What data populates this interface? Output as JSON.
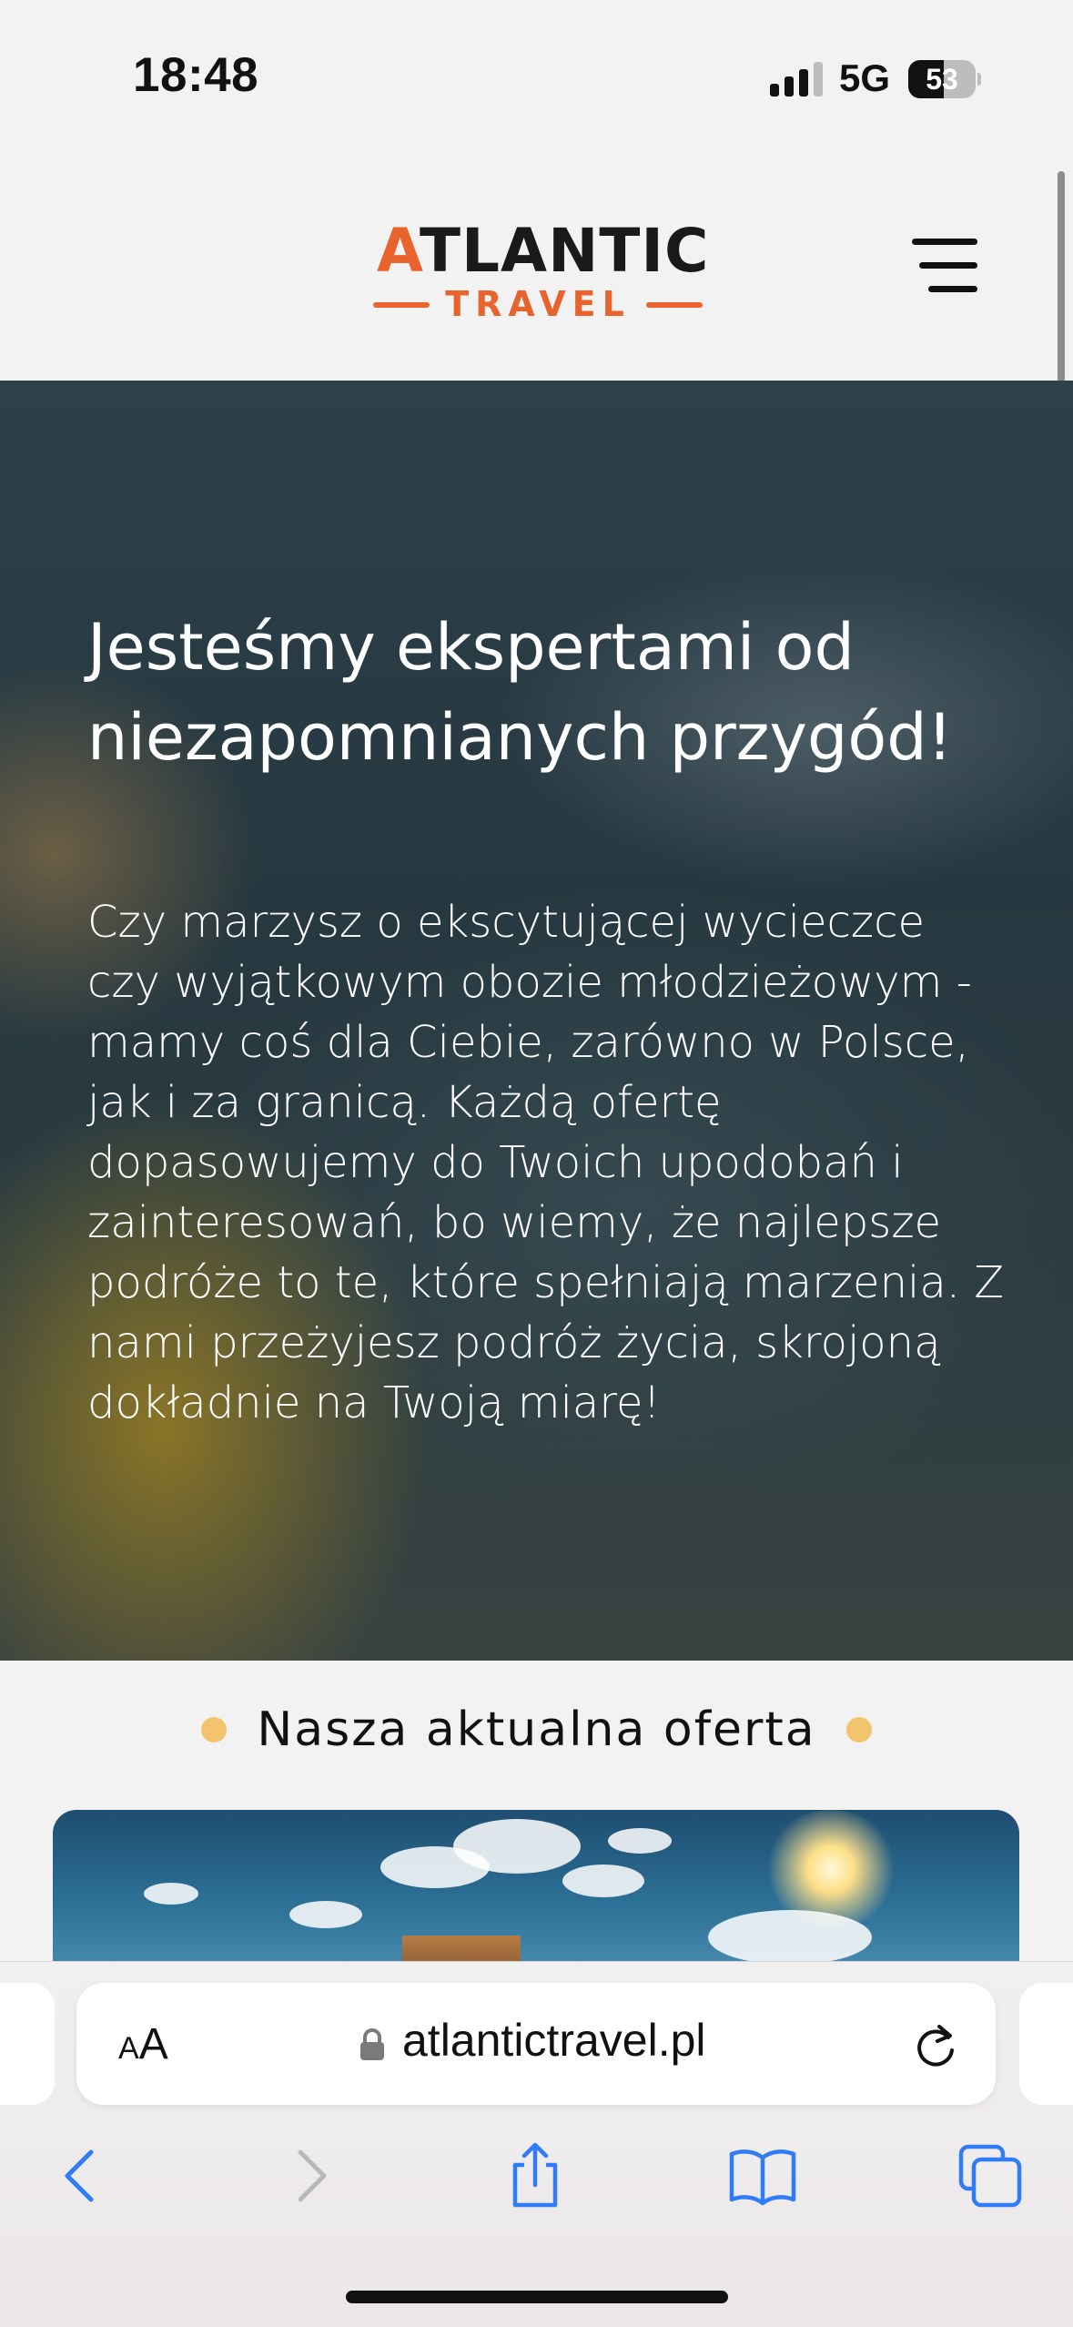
{
  "status_bar": {
    "time": "18:48",
    "network": "5G",
    "battery_level": "53",
    "battery_fraction": 0.53
  },
  "header": {
    "logo_main": "ATLANTIC",
    "logo_first_letter": "A",
    "logo_rest": "TLANTIC",
    "logo_sub": "TRAVEL",
    "menu_icon": "hamburger-icon",
    "brand_color": "#e8642c"
  },
  "hero": {
    "title": "Jesteśmy ekspertami od niezapomnianych przygód!",
    "text": "Czy marzysz o ekscytującej wycieczce czy wyjątkowym obozie młodzieżowym - mamy coś dla Ciebie, zarówno w Polsce, jak i za granicą. Każdą ofertę dopasowujemy do Twoich upodobań i zainteresowań, bo wiemy, że najlepsze podróże to te, które spełniają marzenia. Z nami przeżyjesz podróż życia, skrojoną dokładnie na Twoją miarę!"
  },
  "offer": {
    "heading": "Nasza aktualna oferta",
    "dot_color": "#f2c46d"
  },
  "browser": {
    "text_size_label": "AA",
    "url": "atlantictravel.pl",
    "icons": {
      "lock": "lock-icon",
      "reload": "reload-icon",
      "back": "back-icon",
      "forward": "forward-icon",
      "share": "share-icon",
      "bookmarks": "bookmarks-icon",
      "tabs": "tabs-icon"
    },
    "accent_color": "#2f7cf6"
  }
}
